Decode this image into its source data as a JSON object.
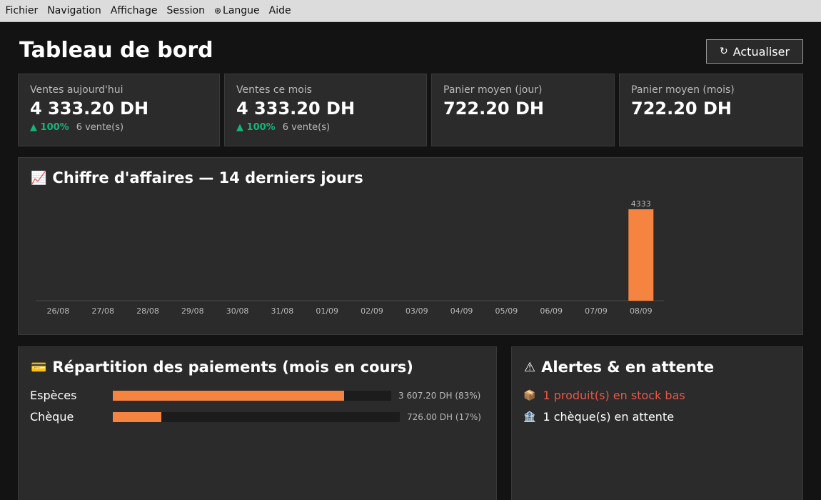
{
  "menu": [
    "Fichier",
    "Navigation",
    "Affichage",
    "Session",
    "Langue",
    "Aide"
  ],
  "header": {
    "title": "Tableau de bord",
    "refresh_label": "Actualiser"
  },
  "kpis": [
    {
      "label": "Ventes aujourd'hui",
      "value": "4 333.20 DH",
      "trend": "▲ 100%",
      "count": "6 vente(s)"
    },
    {
      "label": "Ventes ce mois",
      "value": "4 333.20 DH",
      "trend": "▲ 100%",
      "count": "6 vente(s)"
    },
    {
      "label": "Panier moyen (jour)",
      "value": "722.20 DH"
    },
    {
      "label": "Panier moyen (mois)",
      "value": "722.20 DH"
    }
  ],
  "revenue": {
    "title": "Chiffre d'affaires — 14 derniers jours",
    "chart_data": {
      "type": "bar",
      "categories": [
        "26/08",
        "27/08",
        "28/08",
        "29/08",
        "30/08",
        "31/08",
        "01/09",
        "02/09",
        "03/09",
        "04/09",
        "05/09",
        "06/09",
        "07/09",
        "08/09"
      ],
      "values": [
        0,
        0,
        0,
        0,
        0,
        0,
        0,
        0,
        0,
        0,
        0,
        0,
        0,
        4333
      ],
      "data_labels": [
        "",
        "",
        "",
        "",
        "",
        "",
        "",
        "",
        "",
        "",
        "",
        "",
        "",
        "4333"
      ],
      "title": "Chiffre d'affaires — 14 derniers jours",
      "xlabel": "",
      "ylabel": "",
      "ylim": [
        0,
        4333
      ],
      "grid": false,
      "bar_color": "#f4843f"
    }
  },
  "payments": {
    "title": "Répartition des paiements (mois en cours)",
    "items": [
      {
        "label": "Espèces",
        "amount": "3 607.20 DH (83%)",
        "share": 0.83
      },
      {
        "label": "Chèque",
        "amount": "726.00 DH (17%)",
        "share": 0.17
      }
    ]
  },
  "alerts": {
    "title": "Alertes & en attente",
    "items": [
      {
        "text": "1 produit(s) en stock bas",
        "icon": "package-icon",
        "level": "danger"
      },
      {
        "text": "1 chèque(s) en attente",
        "icon": "bank-icon",
        "level": "neutral"
      }
    ]
  },
  "colors": {
    "accent": "#f4843f",
    "positive": "#19b37a",
    "danger": "#ee5544",
    "card": "#2b2b2b",
    "background": "#131313"
  }
}
